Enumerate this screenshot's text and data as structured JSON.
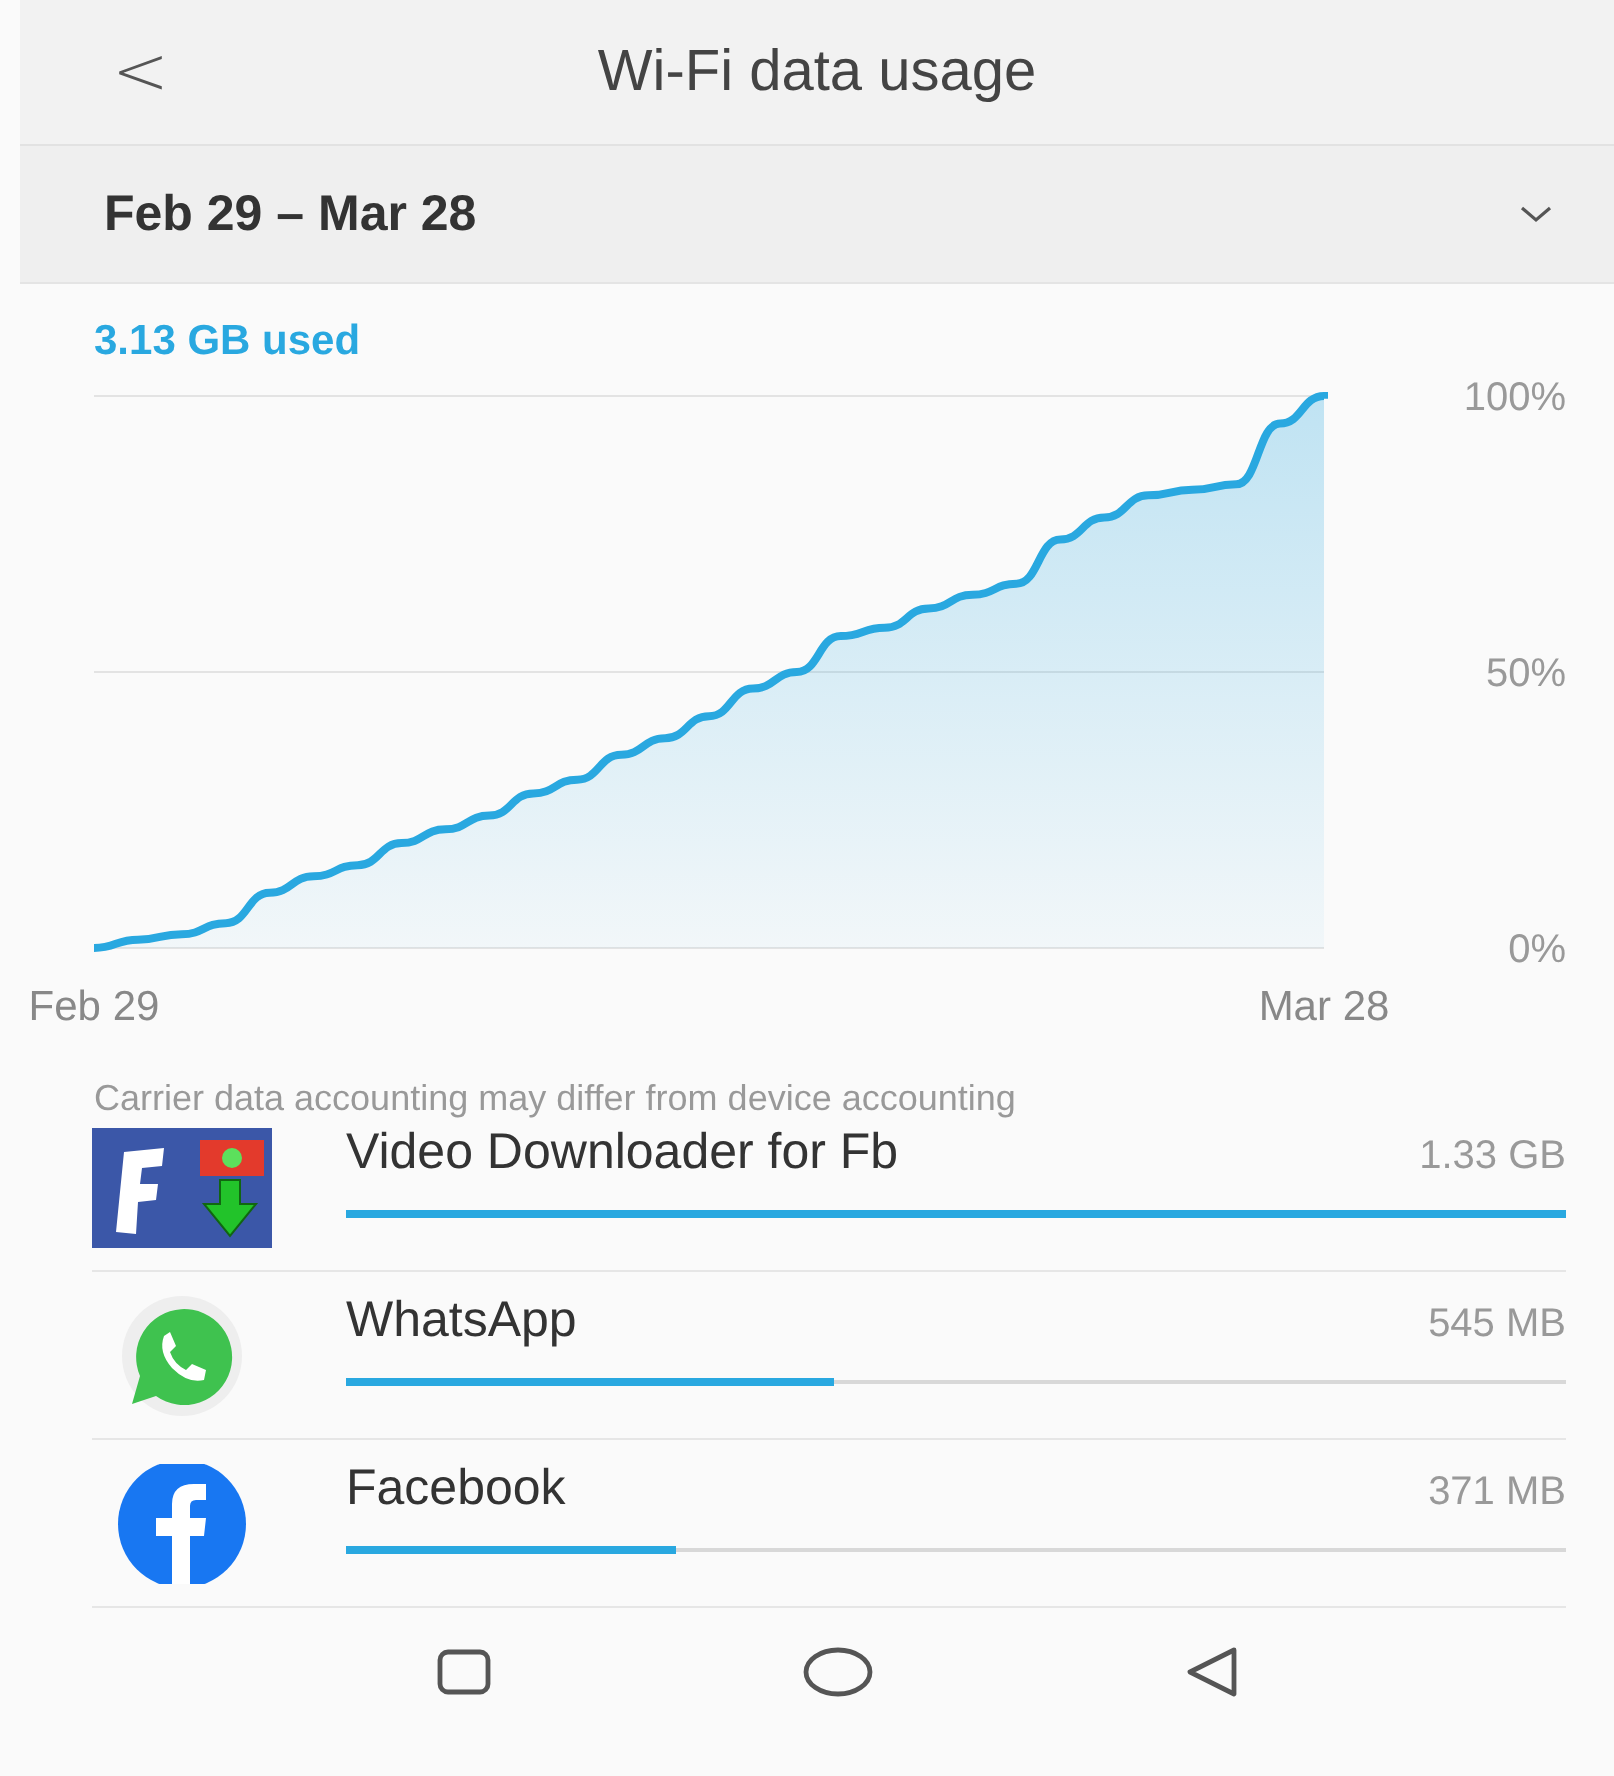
{
  "header": {
    "back": "<",
    "title": "Wi-Fi data usage"
  },
  "period": {
    "label": "Feb 29 – Mar 28",
    "expanded": false
  },
  "usage": {
    "total": "3.13 GB used",
    "chart_data": {
      "type": "area",
      "categories": [
        "Feb 29",
        null,
        null,
        null,
        null,
        null,
        null,
        null,
        null,
        null,
        null,
        null,
        null,
        null,
        null,
        null,
        null,
        null,
        null,
        null,
        null,
        null,
        null,
        null,
        null,
        null,
        null,
        null,
        "Mar 28"
      ],
      "series": [
        {
          "color": "#29a8e0",
          "values": [
            0,
            1.5,
            2.5,
            4.5,
            10,
            13,
            15,
            19,
            21.5,
            24,
            28,
            30.5,
            35,
            38,
            42,
            47,
            50,
            56.5,
            58,
            61.5,
            64,
            66,
            74,
            78,
            82,
            83,
            84,
            95,
            100
          ]
        }
      ],
      "ylim": [
        0,
        100
      ],
      "yticks": [
        {
          "value": 0,
          "label": "0%"
        },
        {
          "value": 50,
          "label": "50%"
        },
        {
          "value": 100,
          "label": "100%"
        }
      ]
    }
  },
  "note": "Carrier data accounting may differ from device accounting",
  "apps": [
    {
      "name": "Video Downloader for Fb",
      "size": "1.33 GB",
      "level": 1.0,
      "kind": "downloader"
    },
    {
      "name": "WhatsApp",
      "size": "545 MB",
      "level": 0.4,
      "kind": "whatsapp"
    },
    {
      "name": "Facebook",
      "size": "371 MB",
      "level": 0.27,
      "kind": "facebook"
    }
  ]
}
